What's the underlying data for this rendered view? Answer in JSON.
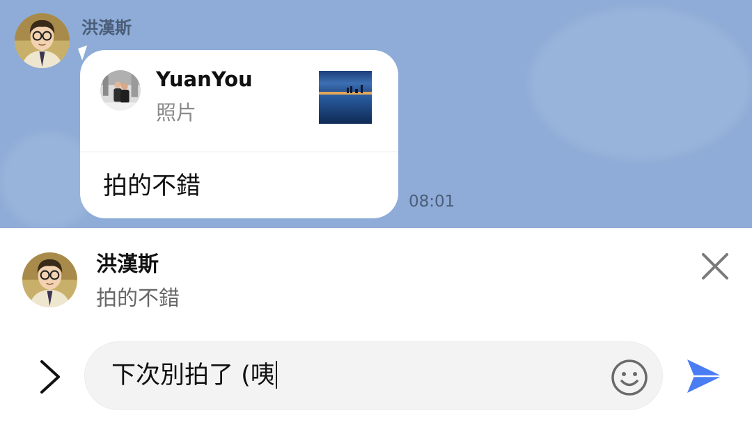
{
  "chat": {
    "background_color": "#8eacd7",
    "message": {
      "sender_name": "洪漢斯",
      "sender_avatar": "cartoon-man-glasses-avatar",
      "quoted": {
        "name": "YuanYou",
        "type_label": "照片",
        "avatar": "couple-photo-avatar",
        "thumbnail": "lake-dusk-photo"
      },
      "text": "拍的不錯",
      "time": "08:01"
    }
  },
  "reply_preview": {
    "name": "洪漢斯",
    "text": "拍的不錯",
    "avatar": "cartoon-man-glasses-avatar",
    "close_icon": "close-icon"
  },
  "composer": {
    "expand_icon": "chevron-right-icon",
    "input_value": "下次別拍了 (咦",
    "emoji_icon": "smiley-icon",
    "send_icon": "send-icon",
    "send_color": "#4a7cf3"
  }
}
